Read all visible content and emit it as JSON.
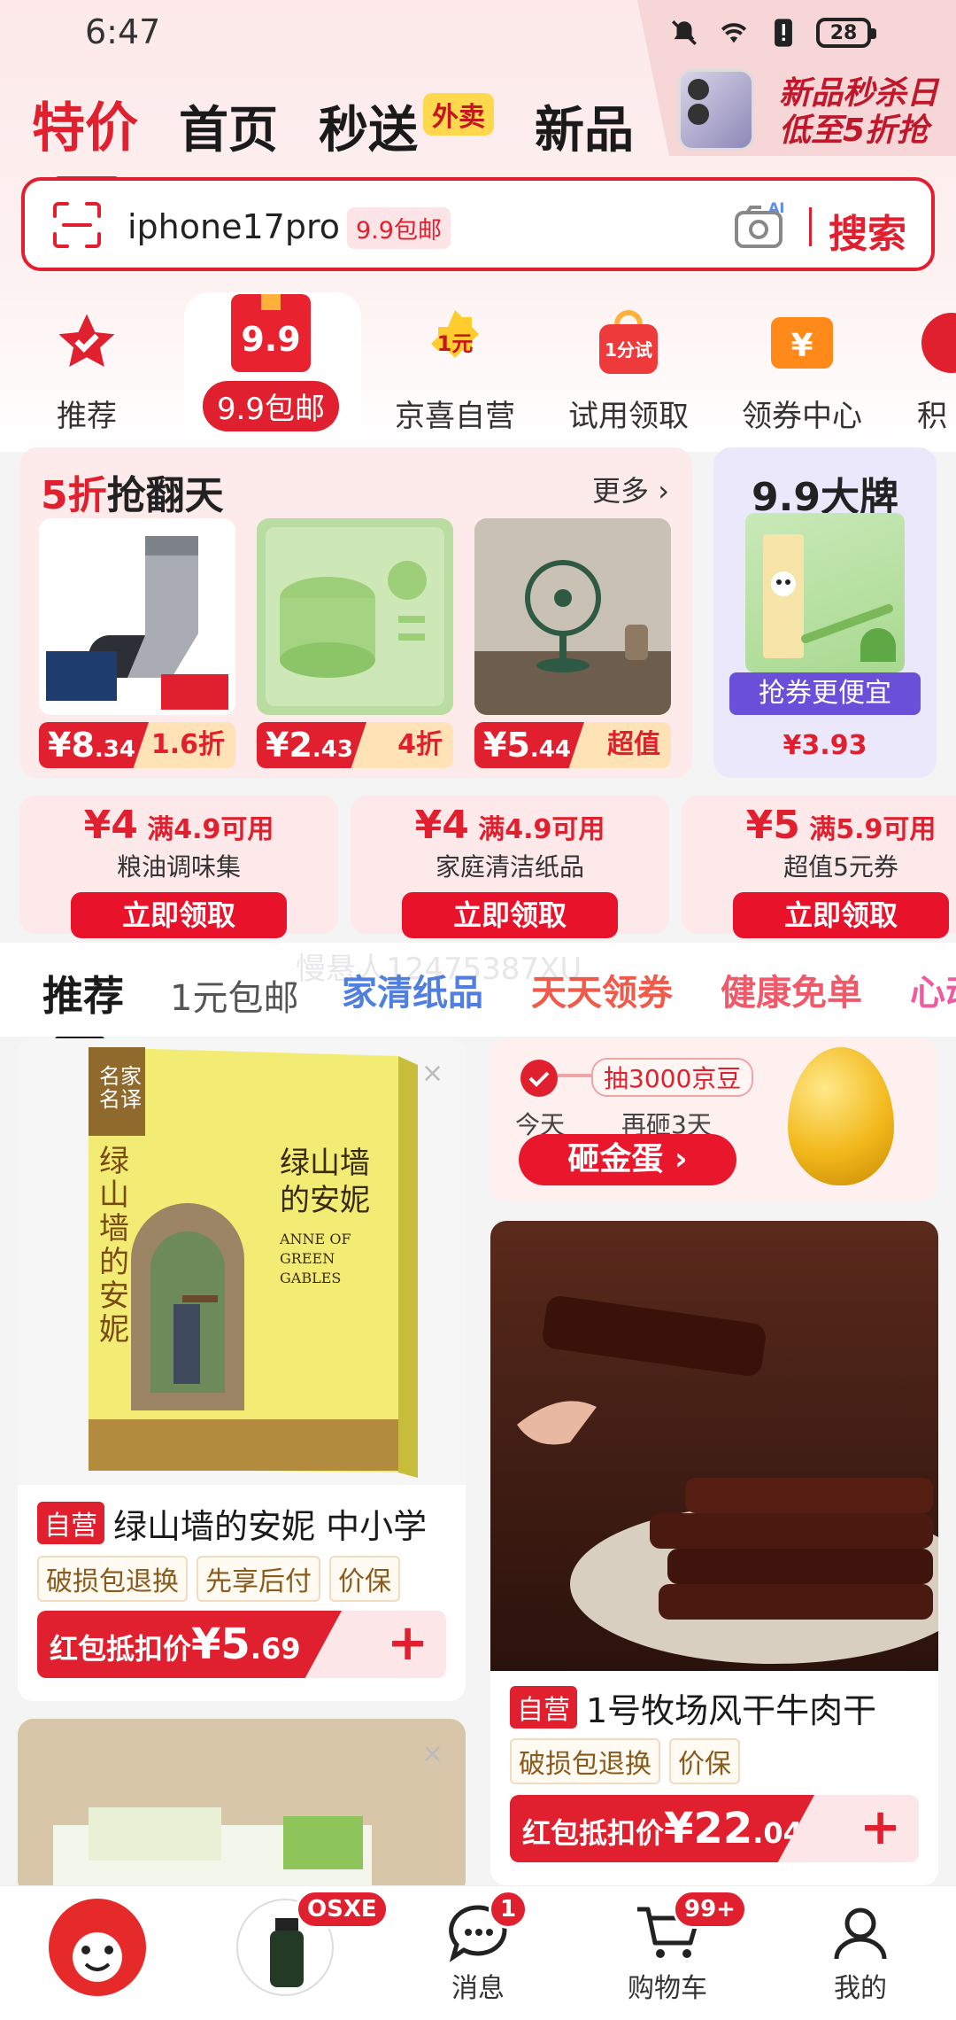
{
  "status": {
    "time": "6:47",
    "battery": "28"
  },
  "promo": {
    "line1": "新品秒杀日",
    "line2": "低至5折抢"
  },
  "tabs": [
    {
      "label": "特价"
    },
    {
      "label": "首页"
    },
    {
      "label": "秒送",
      "badge": "外卖"
    },
    {
      "label": "新品"
    }
  ],
  "search": {
    "query": "iphone17pro",
    "tag": "9.9包邮",
    "camera_ai": "AI",
    "button": "搜索"
  },
  "categories": [
    {
      "label": "推荐",
      "icon": "star-check-icon"
    },
    {
      "label": "9.9包邮",
      "icon": "gift-99-icon",
      "badge": "9.9"
    },
    {
      "label": "京喜自营",
      "icon": "one-yuan-icon",
      "badge": "1元"
    },
    {
      "label": "试用领取",
      "icon": "trial-bag-icon",
      "badge": "1分试"
    },
    {
      "label": "领券中心",
      "icon": "coupon-yen-icon",
      "badge": "¥"
    },
    {
      "label": "积"
    }
  ],
  "deal_section": {
    "title_red": "5折",
    "title_black": "抢翻天",
    "more": "更多",
    "products": [
      {
        "name": "socks",
        "price_yuan": "¥8",
        "price_cents": ".34",
        "discount": "1.6折"
      },
      {
        "name": "ice-mold",
        "price_yuan": "¥2",
        "price_cents": ".43",
        "discount": "4折"
      },
      {
        "name": "desk-fan",
        "price_yuan": "¥5",
        "price_cents": ".44",
        "discount": "超值"
      }
    ]
  },
  "brand_section": {
    "title": "9.9大牌",
    "button": "抢券更便宜",
    "price_yuan": "¥3",
    "price_cents": ".93"
  },
  "coupons": [
    {
      "amount": "¥4",
      "condition": "满4.9可用",
      "desc": "粮油调味集",
      "button": "立即领取"
    },
    {
      "amount": "¥4",
      "condition": "满4.9可用",
      "desc": "家庭清洁纸品",
      "button": "立即领取"
    },
    {
      "amount": "¥5",
      "condition": "满5.9可用",
      "desc": "超值5元券",
      "button": "立即领取"
    }
  ],
  "feed_tabs": [
    {
      "label": "推荐",
      "color": "#1a1a1a"
    },
    {
      "label": "1元包邮",
      "color": "#555555"
    },
    {
      "label": "家清纸品",
      "color": "#4f7fe0"
    },
    {
      "label": "天天领券",
      "color": "#ef5a4a"
    },
    {
      "label": "健康免单",
      "color": "#ef5a6a"
    },
    {
      "label": "心动",
      "color": "#ef5aa0"
    }
  ],
  "watermark": "慢悬人12475387XU",
  "book_card": {
    "book_title": "绿山墙的安妮",
    "book_subtitle": "ANNE OF GREEN GABLES",
    "book_series": "名家名译",
    "self_tag": "自营",
    "title": "绿山墙的安妮 中小学",
    "chips": [
      "破损包退换",
      "先享后付",
      "价保"
    ],
    "price_label": "红包抵扣价",
    "price_yuan": "¥5",
    "price_cents": ".69",
    "add": "+"
  },
  "egg_card": {
    "reward": "抽3000京豆",
    "today": "今天",
    "next": "再砸3天",
    "button": "砸金蛋 ›"
  },
  "beef_card": {
    "self_tag": "自营",
    "title": "1号牧场风干牛肉干",
    "chips": [
      "破损包退换",
      "价保"
    ],
    "price_label": "红包抵扣价",
    "price_yuan": "¥22",
    "price_cents": ".04",
    "add": "+"
  },
  "bottom_nav": [
    {
      "label": "",
      "icon": "jd-mascot-icon"
    },
    {
      "label": "",
      "icon": "product-bottle-icon",
      "badge": "OSXE"
    },
    {
      "label": "消息",
      "icon": "message-icon",
      "badge": "1"
    },
    {
      "label": "购物车",
      "icon": "cart-icon",
      "badge": "99+"
    },
    {
      "label": "我的",
      "icon": "profile-icon"
    }
  ]
}
